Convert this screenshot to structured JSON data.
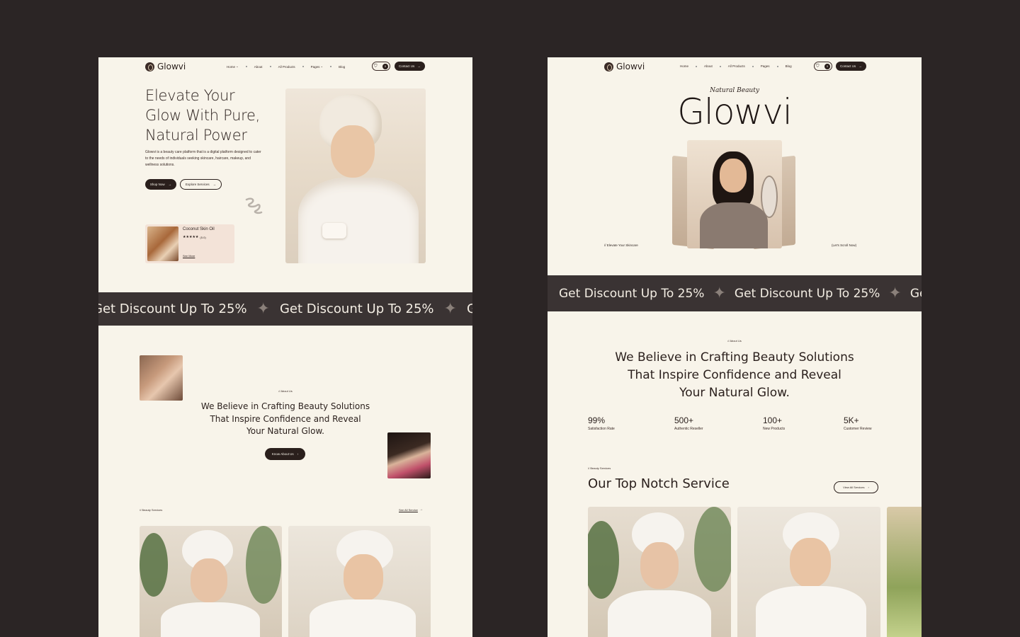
{
  "brand": {
    "name": "Glowvi"
  },
  "nav": {
    "links": [
      "Home",
      "About",
      "All Products",
      "Pages",
      "Blog"
    ],
    "cart_count": "0",
    "contact_label": "Contact Us"
  },
  "hero_left": {
    "title_line1": "Elevate Your",
    "title_line2": "Glow With Pure,",
    "title_line3": "Natural Power",
    "description": "Glowvi is a beauty care platform that is a digital platform designed to cater to the needs of individuals seeking skincare, haircare, makeup, and wellness solutions.",
    "shop_now": "Shop Now",
    "explore": "Explore Services",
    "product": {
      "name": "Coconut Skin Oil",
      "stars": "★★★★★",
      "rating": "(5.0)",
      "link": "See More"
    }
  },
  "marquee": {
    "text": "Get Discount Up To 25%"
  },
  "about_left": {
    "tag": "// About Us",
    "line1": "We Believe in Crafting Beauty Solutions",
    "line2": "That Inspire Confidence and Reveal",
    "line3": "Your Natural Glow.",
    "button": "Know About Us"
  },
  "services_left": {
    "tag": "// Beauty Services",
    "see_all": "See All Service"
  },
  "hero_right": {
    "script_tag": "Natural Beauty",
    "big_title": "Glowvi",
    "left_caption": "// Elevate Your Skincare",
    "right_caption": "(Let's Scroll Now)"
  },
  "about_right": {
    "tag": "// About Us",
    "line1": "We Believe in Crafting Beauty Solutions",
    "line2": "That Inspire Confidence and Reveal",
    "line3": "Your Natural Glow."
  },
  "stats": [
    {
      "value": "99%",
      "label": "Satisfaction Rate"
    },
    {
      "value": "500+",
      "label": "Authentic Reseller"
    },
    {
      "value": "100+",
      "label": "New Products"
    },
    {
      "value": "5K+",
      "label": "Customer Review"
    }
  ],
  "services_right": {
    "tag": "// Beauty Services",
    "title": "Our Top Notch Service",
    "view_all": "View All Services"
  },
  "colors": {
    "cream": "#f8f4ea",
    "dark": "#2a1f1c",
    "marquee_bg": "#3a3333",
    "background": "#2b2525"
  },
  "icons": [
    "cart-icon",
    "arrow-right-icon",
    "star-icon",
    "sparkle-icon",
    "chevron-down-icon"
  ]
}
